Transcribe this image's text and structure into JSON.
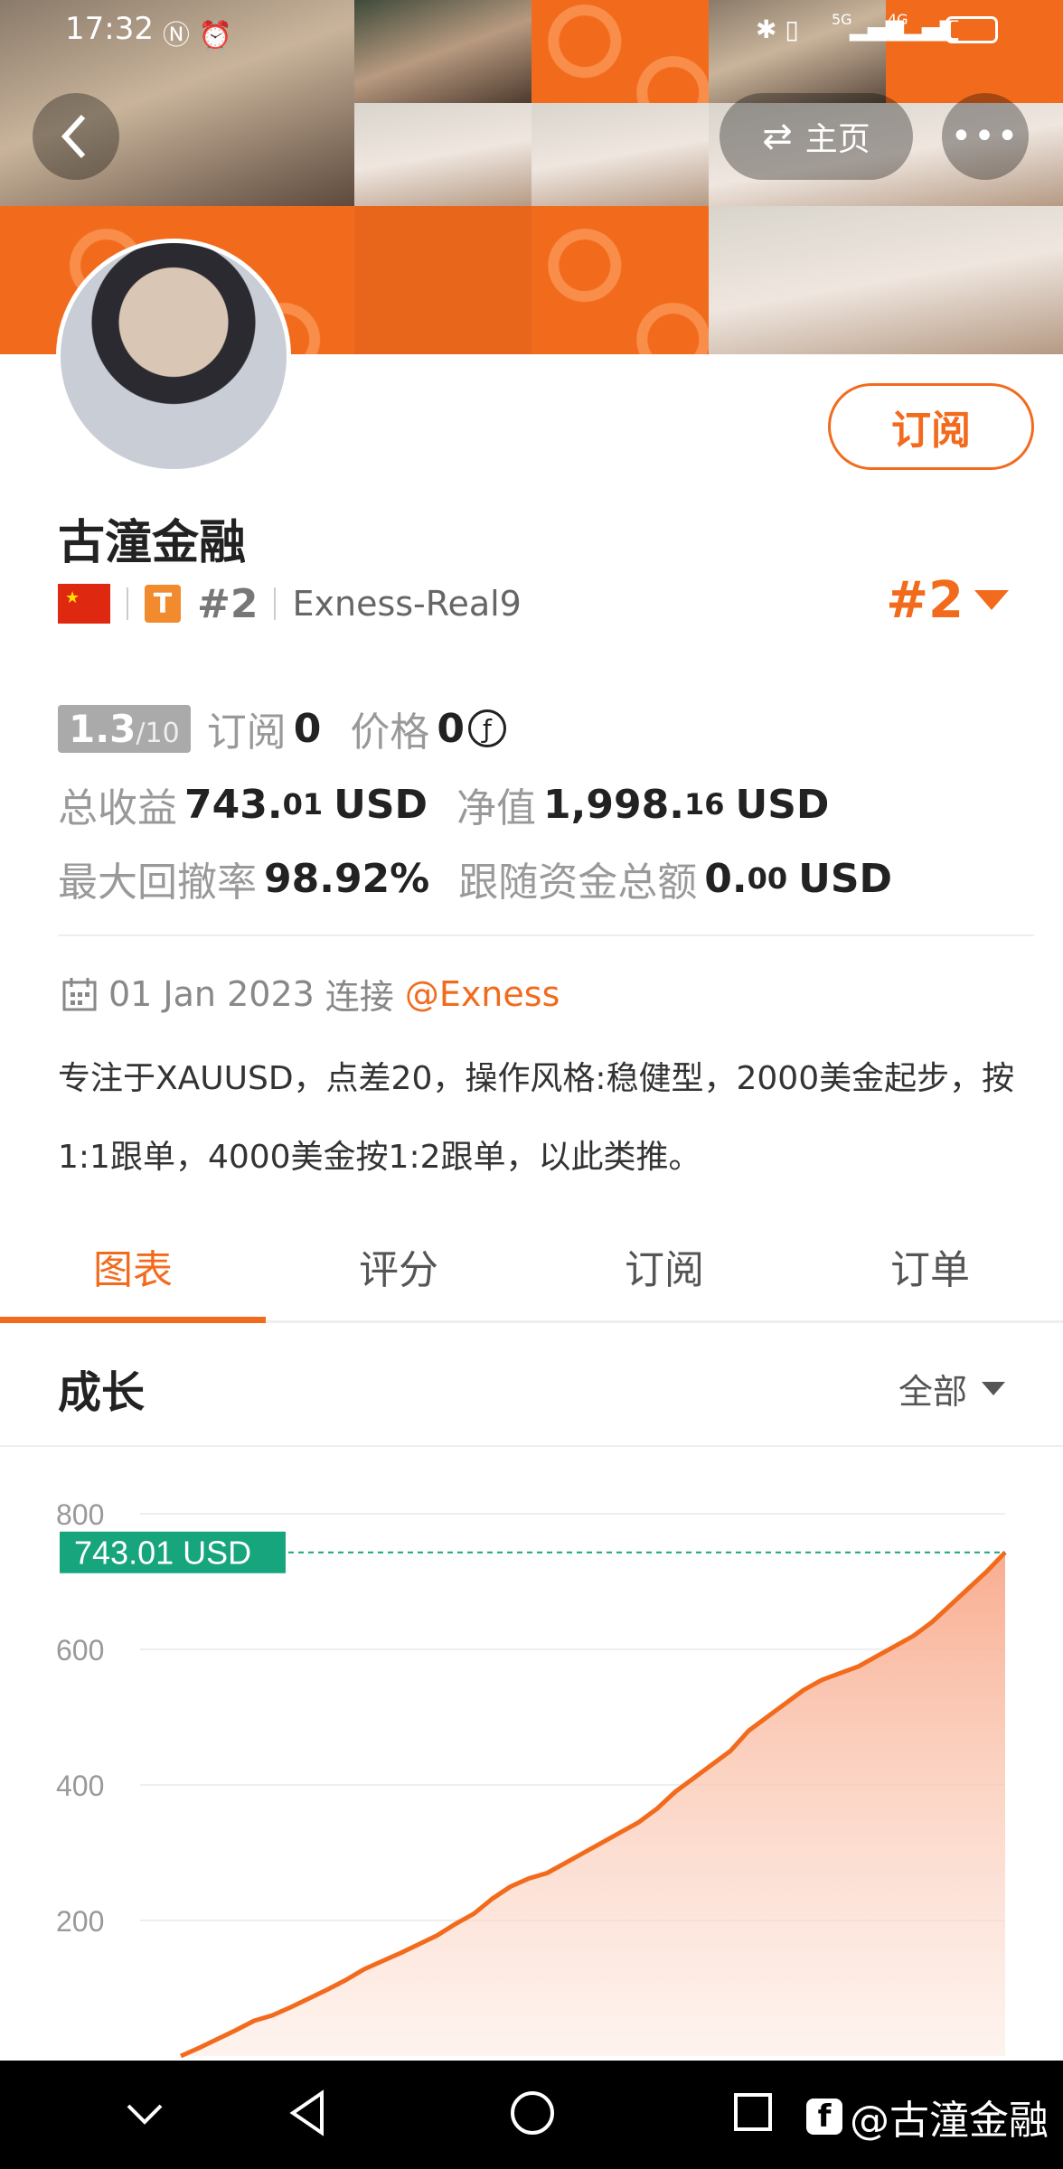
{
  "status_bar": {
    "time": "17:32",
    "network1": "5G",
    "network2": "4G"
  },
  "header": {
    "home_label": "主页"
  },
  "profile": {
    "subscribe_label": "订阅",
    "name": "古潼金融",
    "rank_small": "#2",
    "server": "Exness-Real9",
    "rank_large": "#2",
    "t_badge": "T"
  },
  "metrics": {
    "score": "1.3",
    "score_max": "/10",
    "subscribe_label": "订阅",
    "subscribe_count": "0",
    "price_label": "价格",
    "price_value": "0",
    "total_profit_label": "总收益",
    "total_profit_int": "743.",
    "total_profit_dec": "01",
    "total_profit_unit": "USD",
    "equity_label": "净值",
    "equity_int": "1,998.",
    "equity_dec": "16",
    "equity_unit": "USD",
    "max_drawdown_label": "最大回撤率",
    "max_drawdown_value": "98.92%",
    "follow_funds_label": "跟随资金总额",
    "follow_funds_int": "0.",
    "follow_funds_dec": "00",
    "follow_funds_unit": "USD"
  },
  "connection": {
    "date": "01 Jan 2023",
    "connect_label": "连接",
    "broker": "@Exness"
  },
  "description": "专注于XAUUSD，点差20，操作风格:稳健型，2000美金起步，按1:1跟单，4000美金按1:2跟单，以此类推。",
  "tabs": [
    "图表",
    "评分",
    "订阅",
    "订单"
  ],
  "active_tab": 0,
  "section": {
    "title": "成长",
    "filter": "全部"
  },
  "colors": {
    "accent": "#f26b1d",
    "label_green": "#17a57e"
  },
  "chart_data": {
    "type": "area",
    "title": "成长",
    "yticks": [
      "800",
      "600",
      "400",
      "200"
    ],
    "ylim": [
      0,
      800
    ],
    "current_label": "743.01 USD",
    "current_value": 743.01,
    "values": [
      0,
      12,
      25,
      38,
      52,
      60,
      72,
      85,
      98,
      112,
      128,
      140,
      152,
      165,
      178,
      195,
      210,
      232,
      250,
      262,
      270,
      285,
      300,
      315,
      330,
      345,
      365,
      390,
      410,
      430,
      450,
      480,
      500,
      520,
      540,
      555,
      565,
      575,
      590,
      605,
      620,
      640,
      665,
      690,
      715,
      743.01
    ]
  },
  "watermark": "@古潼金融"
}
